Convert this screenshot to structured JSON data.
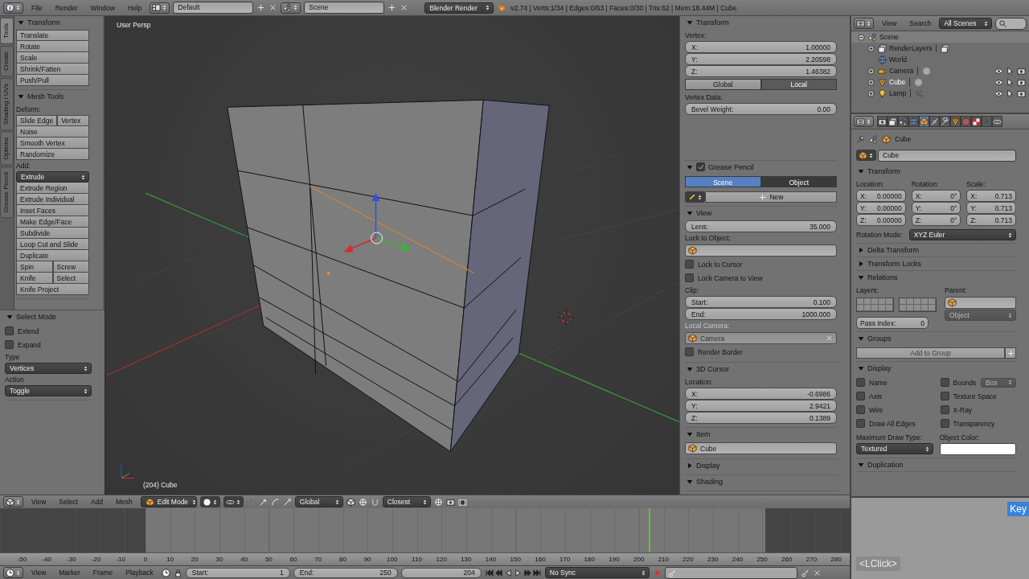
{
  "top_bar": {
    "menus": [
      "File",
      "Render",
      "Window",
      "Help"
    ],
    "layout": "Default",
    "scene": "Scene",
    "engine": "Blender Render",
    "stats": "v2.74 | Verts:1/34 | Edges:0/63 | Faces:0/30 | Tris:62 | Mem:18.44M | Cube"
  },
  "tool_tabs": [
    {
      "label": "Tools",
      "selected": true
    },
    {
      "label": "Create",
      "selected": false
    },
    {
      "label": "Shading / UVs",
      "selected": false
    },
    {
      "label": "Options",
      "selected": false
    },
    {
      "label": "Grease Pencil",
      "selected": false
    }
  ],
  "tool_shelf": [
    {
      "title": "Transform",
      "expanded": true,
      "rows": [
        {
          "kind": "buttons",
          "items": [
            "Translate"
          ]
        },
        {
          "kind": "buttons",
          "items": [
            "Rotate"
          ]
        },
        {
          "kind": "buttons",
          "items": [
            "Scale"
          ]
        },
        {
          "kind": "buttons",
          "items": [
            "Shrink/Fatten"
          ]
        },
        {
          "kind": "buttons",
          "items": [
            "Push/Pull"
          ]
        }
      ]
    },
    {
      "title": "Mesh Tools",
      "expanded": true,
      "rows": [
        {
          "kind": "label",
          "text": "Deform:",
          "disabled": false
        },
        {
          "kind": "buttons",
          "items": [
            "Slide Edge",
            "Vertex"
          ]
        },
        {
          "kind": "buttons",
          "items": [
            "Noise"
          ]
        },
        {
          "kind": "buttons",
          "items": [
            "Smooth Vertex"
          ]
        },
        {
          "kind": "buttons",
          "items": [
            "Randomize"
          ]
        },
        {
          "kind": "label",
          "text": "Add:",
          "disabled": false
        },
        {
          "kind": "dropdown",
          "value": "Extrude"
        },
        {
          "kind": "buttons",
          "items": [
            "Extrude Region"
          ]
        },
        {
          "kind": "buttons",
          "items": [
            "Extrude Individual"
          ]
        },
        {
          "kind": "buttons",
          "items": [
            "Inset Faces"
          ]
        },
        {
          "kind": "buttons",
          "items": [
            "Make Edge/Face"
          ]
        },
        {
          "kind": "buttons",
          "items": [
            "Subdivide"
          ]
        },
        {
          "kind": "buttons",
          "items": [
            "Loop Cut and Slide"
          ]
        },
        {
          "kind": "buttons",
          "items": [
            "Duplicate"
          ]
        },
        {
          "kind": "buttons",
          "items": [
            "Spin",
            "Screw"
          ]
        },
        {
          "kind": "buttons",
          "items": [
            "Knife",
            "Select"
          ]
        },
        {
          "kind": "buttons",
          "items": [
            "Knife Project"
          ]
        }
      ]
    }
  ],
  "operator_panel": {
    "title": "Select Mode",
    "expanded": true,
    "rows": [
      {
        "kind": "checkbox",
        "label": "Extend",
        "checked": false
      },
      {
        "kind": "checkbox",
        "label": "Expand",
        "checked": false
      },
      {
        "kind": "label",
        "text": "Type",
        "disabled": false
      },
      {
        "kind": "dropdown",
        "value": "Vertices"
      },
      {
        "kind": "label",
        "text": "Action",
        "disabled": false
      },
      {
        "kind": "dropdown",
        "value": "Toggle"
      }
    ]
  },
  "viewport": {
    "view_name": "User Persp",
    "object_info": "(204) Cube"
  },
  "n_panel": [
    {
      "title": "Transform",
      "expanded": true,
      "rows": [
        {
          "kind": "label",
          "text": "Vertex:",
          "disabled": false
        },
        {
          "kind": "number",
          "label": "X:",
          "value": "1.00000"
        },
        {
          "kind": "number",
          "label": "Y:",
          "value": "2.20598"
        },
        {
          "kind": "number",
          "label": "Z:",
          "value": "1.46382"
        },
        {
          "kind": "segmented",
          "items": [
            {
              "label": "Global",
              "selected": false
            },
            {
              "label": "Local",
              "selected": true
            }
          ]
        },
        {
          "kind": "label",
          "text": "Vertex Data:",
          "disabled": false
        },
        {
          "kind": "number",
          "label": "Bevel Weight:",
          "value": "0.00"
        }
      ]
    },
    {
      "title": "Grease Pencil",
      "expanded": true,
      "checked": true,
      "rows": [
        {
          "kind": "tabs",
          "items": [
            {
              "label": "Scene",
              "selected": true
            },
            {
              "label": "Object",
              "selected": false
            }
          ]
        },
        {
          "kind": "new",
          "label": "New"
        }
      ]
    },
    {
      "title": "View",
      "expanded": true,
      "rows": [
        {
          "kind": "number",
          "label": "Lens:",
          "value": "35.000"
        },
        {
          "kind": "label",
          "text": "Lock to Object:",
          "disabled": false
        },
        {
          "kind": "object",
          "disabled": false,
          "clearable": false
        },
        {
          "kind": "checkbox",
          "label": "Lock to Cursor",
          "checked": false
        },
        {
          "kind": "checkbox",
          "label": "Lock Camera to View",
          "checked": false
        },
        {
          "kind": "label",
          "text": "Clip:",
          "disabled": false
        },
        {
          "kind": "number",
          "label": "Start:",
          "value": "0.100"
        },
        {
          "kind": "number",
          "label": "End:",
          "value": "1000.000"
        },
        {
          "kind": "label",
          "text": "Local Camera:",
          "disabled": true
        },
        {
          "kind": "object",
          "value": "Camera",
          "disabled": true,
          "clearable": true
        },
        {
          "kind": "checkbox",
          "label": "Render Border",
          "checked": false
        }
      ]
    },
    {
      "title": "3D Cursor",
      "expanded": true,
      "rows": [
        {
          "kind": "label",
          "text": "Location:",
          "disabled": false
        },
        {
          "kind": "number",
          "label": "X:",
          "value": "-0.6986"
        },
        {
          "kind": "number",
          "label": "Y:",
          "value": "2.9421"
        },
        {
          "kind": "number",
          "label": "Z:",
          "value": "0.1389"
        }
      ]
    },
    {
      "title": "Item",
      "expanded": true,
      "rows": [
        {
          "kind": "object",
          "value": "Cube",
          "disabled": false,
          "clearable": false
        }
      ]
    },
    {
      "title": "Display",
      "expanded": false
    },
    {
      "title": "Shading",
      "expanded": true
    }
  ],
  "outliner": {
    "menus": [
      "View",
      "Search"
    ],
    "filter": "All Scenes",
    "tree": [
      {
        "name": "Scene",
        "kind": "scene",
        "expanded": true,
        "selected": false,
        "children": [
          {
            "name": "RenderLayers",
            "kind": "render_layers",
            "expanded": false,
            "selected": false
          },
          {
            "name": "World",
            "kind": "world",
            "selected": false
          },
          {
            "name": "Camera",
            "kind": "camera",
            "expanded": false,
            "selected": false
          },
          {
            "name": "Cube",
            "kind": "mesh",
            "expanded": false,
            "selected": true
          },
          {
            "name": "Lamp",
            "kind": "lamp",
            "expanded": false,
            "selected": false
          }
        ]
      }
    ]
  },
  "properties": {
    "tabs": [
      {
        "kind": "render",
        "selected": false
      },
      {
        "kind": "render_layers",
        "selected": false
      },
      {
        "kind": "scene",
        "selected": false
      },
      {
        "kind": "world",
        "selected": false
      },
      {
        "kind": "object",
        "selected": true
      },
      {
        "kind": "constraints",
        "selected": false
      },
      {
        "kind": "modifiers",
        "selected": false
      },
      {
        "kind": "data",
        "selected": false
      },
      {
        "kind": "material",
        "selected": false
      },
      {
        "kind": "texture",
        "selected": false
      },
      {
        "kind": "particles",
        "selected": false
      },
      {
        "kind": "physics",
        "selected": false
      }
    ],
    "breadcrumb": "Cube",
    "object_name": "Cube",
    "panels": [
      {
        "kind": "transform",
        "title": "Transform",
        "expanded": true,
        "columns": [
          {
            "label": "Location:",
            "fields": [
              {
                "label": "X:",
                "value": "0.00000"
              },
              {
                "label": "Y:",
                "value": "0.00000"
              },
              {
                "label": "Z:",
                "value": "0.00000"
              }
            ]
          },
          {
            "label": "Rotation:",
            "fields": [
              {
                "label": "X:",
                "value": "0°"
              },
              {
                "label": "Y:",
                "value": "0°"
              },
              {
                "label": "Z:",
                "value": "0°"
              }
            ]
          },
          {
            "label": "Scale:",
            "fields": [
              {
                "label": "X:",
                "value": "0.713"
              },
              {
                "label": "Y:",
                "value": "0.713"
              },
              {
                "label": "Z:",
                "value": "0.713"
              }
            ]
          }
        ],
        "mode_label": "Rotation Mode:",
        "mode": "XYZ Euler"
      },
      {
        "kind": "plain",
        "title": "Delta Transform",
        "expanded": false
      },
      {
        "kind": "plain",
        "title": "Transform Locks",
        "expanded": false
      },
      {
        "kind": "relations",
        "title": "Relations",
        "expanded": true,
        "layers_label": "Layers:",
        "parent_label": "Parent:",
        "parent_type": "Object",
        "pass_index_label": "Pass Index:",
        "pass_index": "0"
      },
      {
        "kind": "groups",
        "title": "Groups",
        "expanded": true,
        "button": "Add to Group"
      },
      {
        "kind": "display",
        "title": "Display",
        "expanded": true,
        "options": [
          {
            "label": "Name",
            "checked": false
          },
          {
            "label": "Bounds",
            "checked": false,
            "dropdown": "Box"
          },
          {
            "label": "Axis",
            "checked": false
          },
          {
            "label": "Texture Space",
            "checked": false
          },
          {
            "label": "Wire",
            "checked": false
          },
          {
            "label": "X-Ray",
            "checked": false
          },
          {
            "label": "Draw All Edges",
            "checked": false
          },
          {
            "label": "Transparency",
            "checked": false
          }
        ],
        "draw_type_label": "Maximum Draw Type:",
        "draw_type": "Textured",
        "color_label": "Object Color:"
      },
      {
        "kind": "plain",
        "title": "Duplication",
        "expanded": true
      }
    ]
  },
  "view3d_header": {
    "menus": [
      "View",
      "Select",
      "Add",
      "Mesh"
    ],
    "mode": "Edit Mode",
    "orientation": "Global",
    "snap_target": "Closest"
  },
  "timeline": {
    "ruler_labels": [
      "-50",
      "-40",
      "-30",
      "-20",
      "-10",
      "0",
      "10",
      "20",
      "30",
      "40",
      "50",
      "60",
      "70",
      "80",
      "90",
      "100",
      "110",
      "120",
      "130",
      "140",
      "150",
      "160",
      "170",
      "180",
      "190",
      "200",
      "210",
      "220",
      "230",
      "240",
      "250",
      "260",
      "270",
      "280"
    ],
    "menus": [
      "View",
      "Marker",
      "Frame",
      "Playback"
    ],
    "start": {
      "label": "Start:",
      "value": "1"
    },
    "end": {
      "label": "End:",
      "value": "250"
    },
    "current": "204",
    "sync": "No Sync"
  },
  "key_overlay": {
    "key": "Key",
    "event": "<LClick>"
  }
}
